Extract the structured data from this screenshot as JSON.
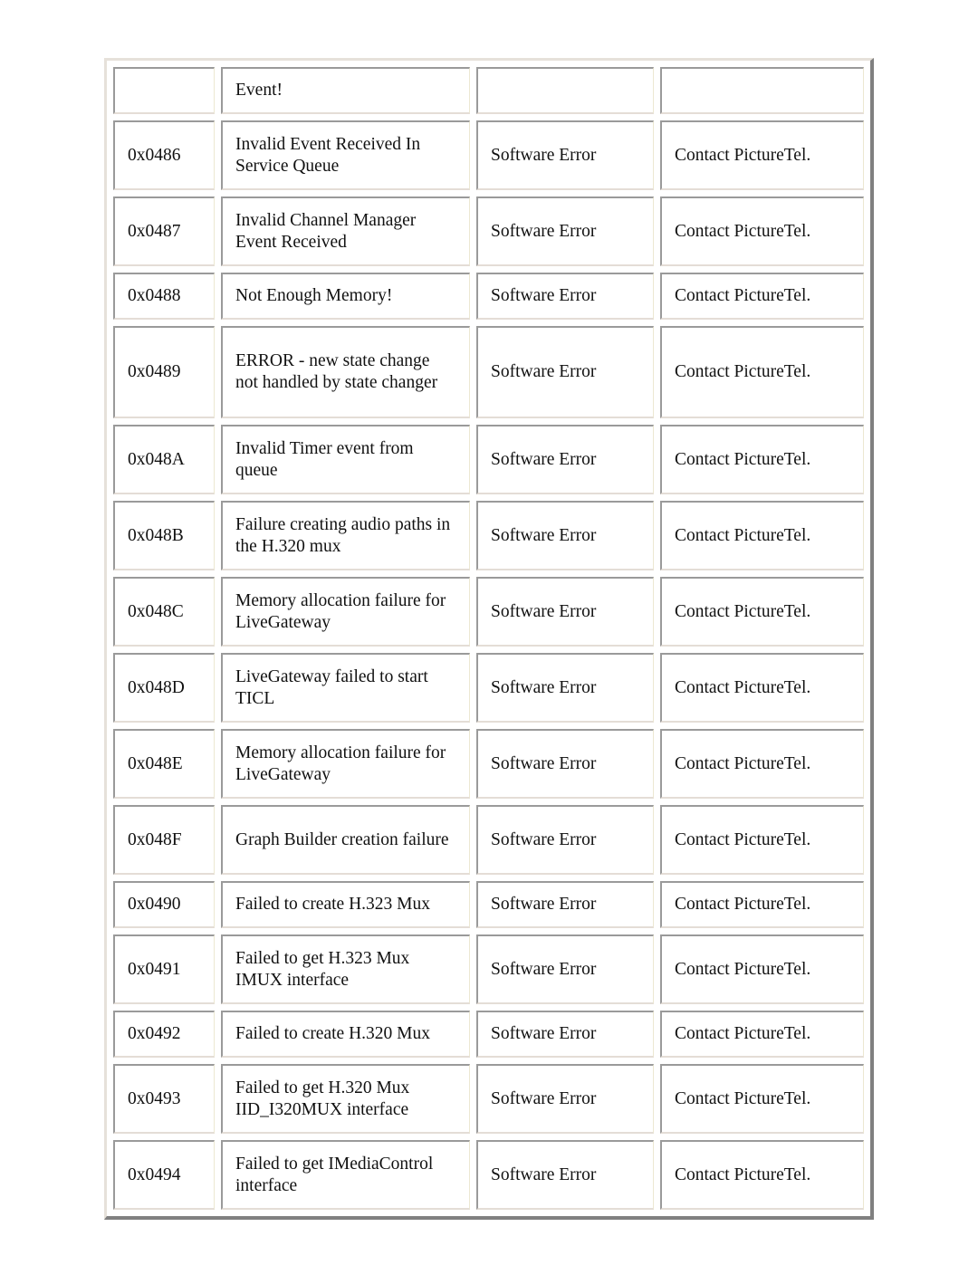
{
  "table": {
    "rows": [
      {
        "code": "",
        "description": "Event!",
        "type": "",
        "action": ""
      },
      {
        "code": "0x0486",
        "description": "Invalid Event Received In Service Queue",
        "type": "Software Error",
        "action": "Contact PictureTel."
      },
      {
        "code": "0x0487",
        "description": "Invalid Channel Manager Event Received",
        "type": "Software Error",
        "action": "Contact PictureTel."
      },
      {
        "code": "0x0488",
        "description": "Not Enough Memory!",
        "type": "Software Error",
        "action": "Contact PictureTel."
      },
      {
        "code": "0x0489",
        "description": "ERROR - new state change not handled by state changer",
        "type": "Software Error",
        "action": "Contact PictureTel."
      },
      {
        "code": "0x048A",
        "description": "Invalid Timer event from queue",
        "type": "Software Error",
        "action": "Contact PictureTel."
      },
      {
        "code": "0x048B",
        "description": "Failure creating audio paths in the H.320 mux",
        "type": "Software Error",
        "action": "Contact PictureTel."
      },
      {
        "code": "0x048C",
        "description": "Memory allocation failure for LiveGateway",
        "type": "Software Error",
        "action": "Contact PictureTel."
      },
      {
        "code": "0x048D",
        "description": "LiveGateway failed to start TICL",
        "type": "Software Error",
        "action": "Contact PictureTel."
      },
      {
        "code": "0x048E",
        "description": "Memory allocation failure for LiveGateway",
        "type": "Software Error",
        "action": "Contact PictureTel."
      },
      {
        "code": "0x048F",
        "description": "Graph Builder creation failure",
        "type": "Software Error",
        "action": "Contact PictureTel."
      },
      {
        "code": "0x0490",
        "description": "Failed to create H.323 Mux",
        "type": "Software Error",
        "action": "Contact PictureTel."
      },
      {
        "code": "0x0491",
        "description": "Failed to get H.323 Mux IMUX interface",
        "type": "Software Error",
        "action": "Contact PictureTel."
      },
      {
        "code": "0x0492",
        "description": "Failed to create H.320 Mux",
        "type": "Software Error",
        "action": "Contact PictureTel."
      },
      {
        "code": "0x0493",
        "description": "Failed to get H.320 Mux IID_I320MUX interface",
        "type": "Software Error",
        "action": "Contact PictureTel."
      },
      {
        "code": "0x0494",
        "description": "Failed to get IMediaControl interface",
        "type": "Software Error",
        "action": "Contact PictureTel."
      }
    ]
  }
}
